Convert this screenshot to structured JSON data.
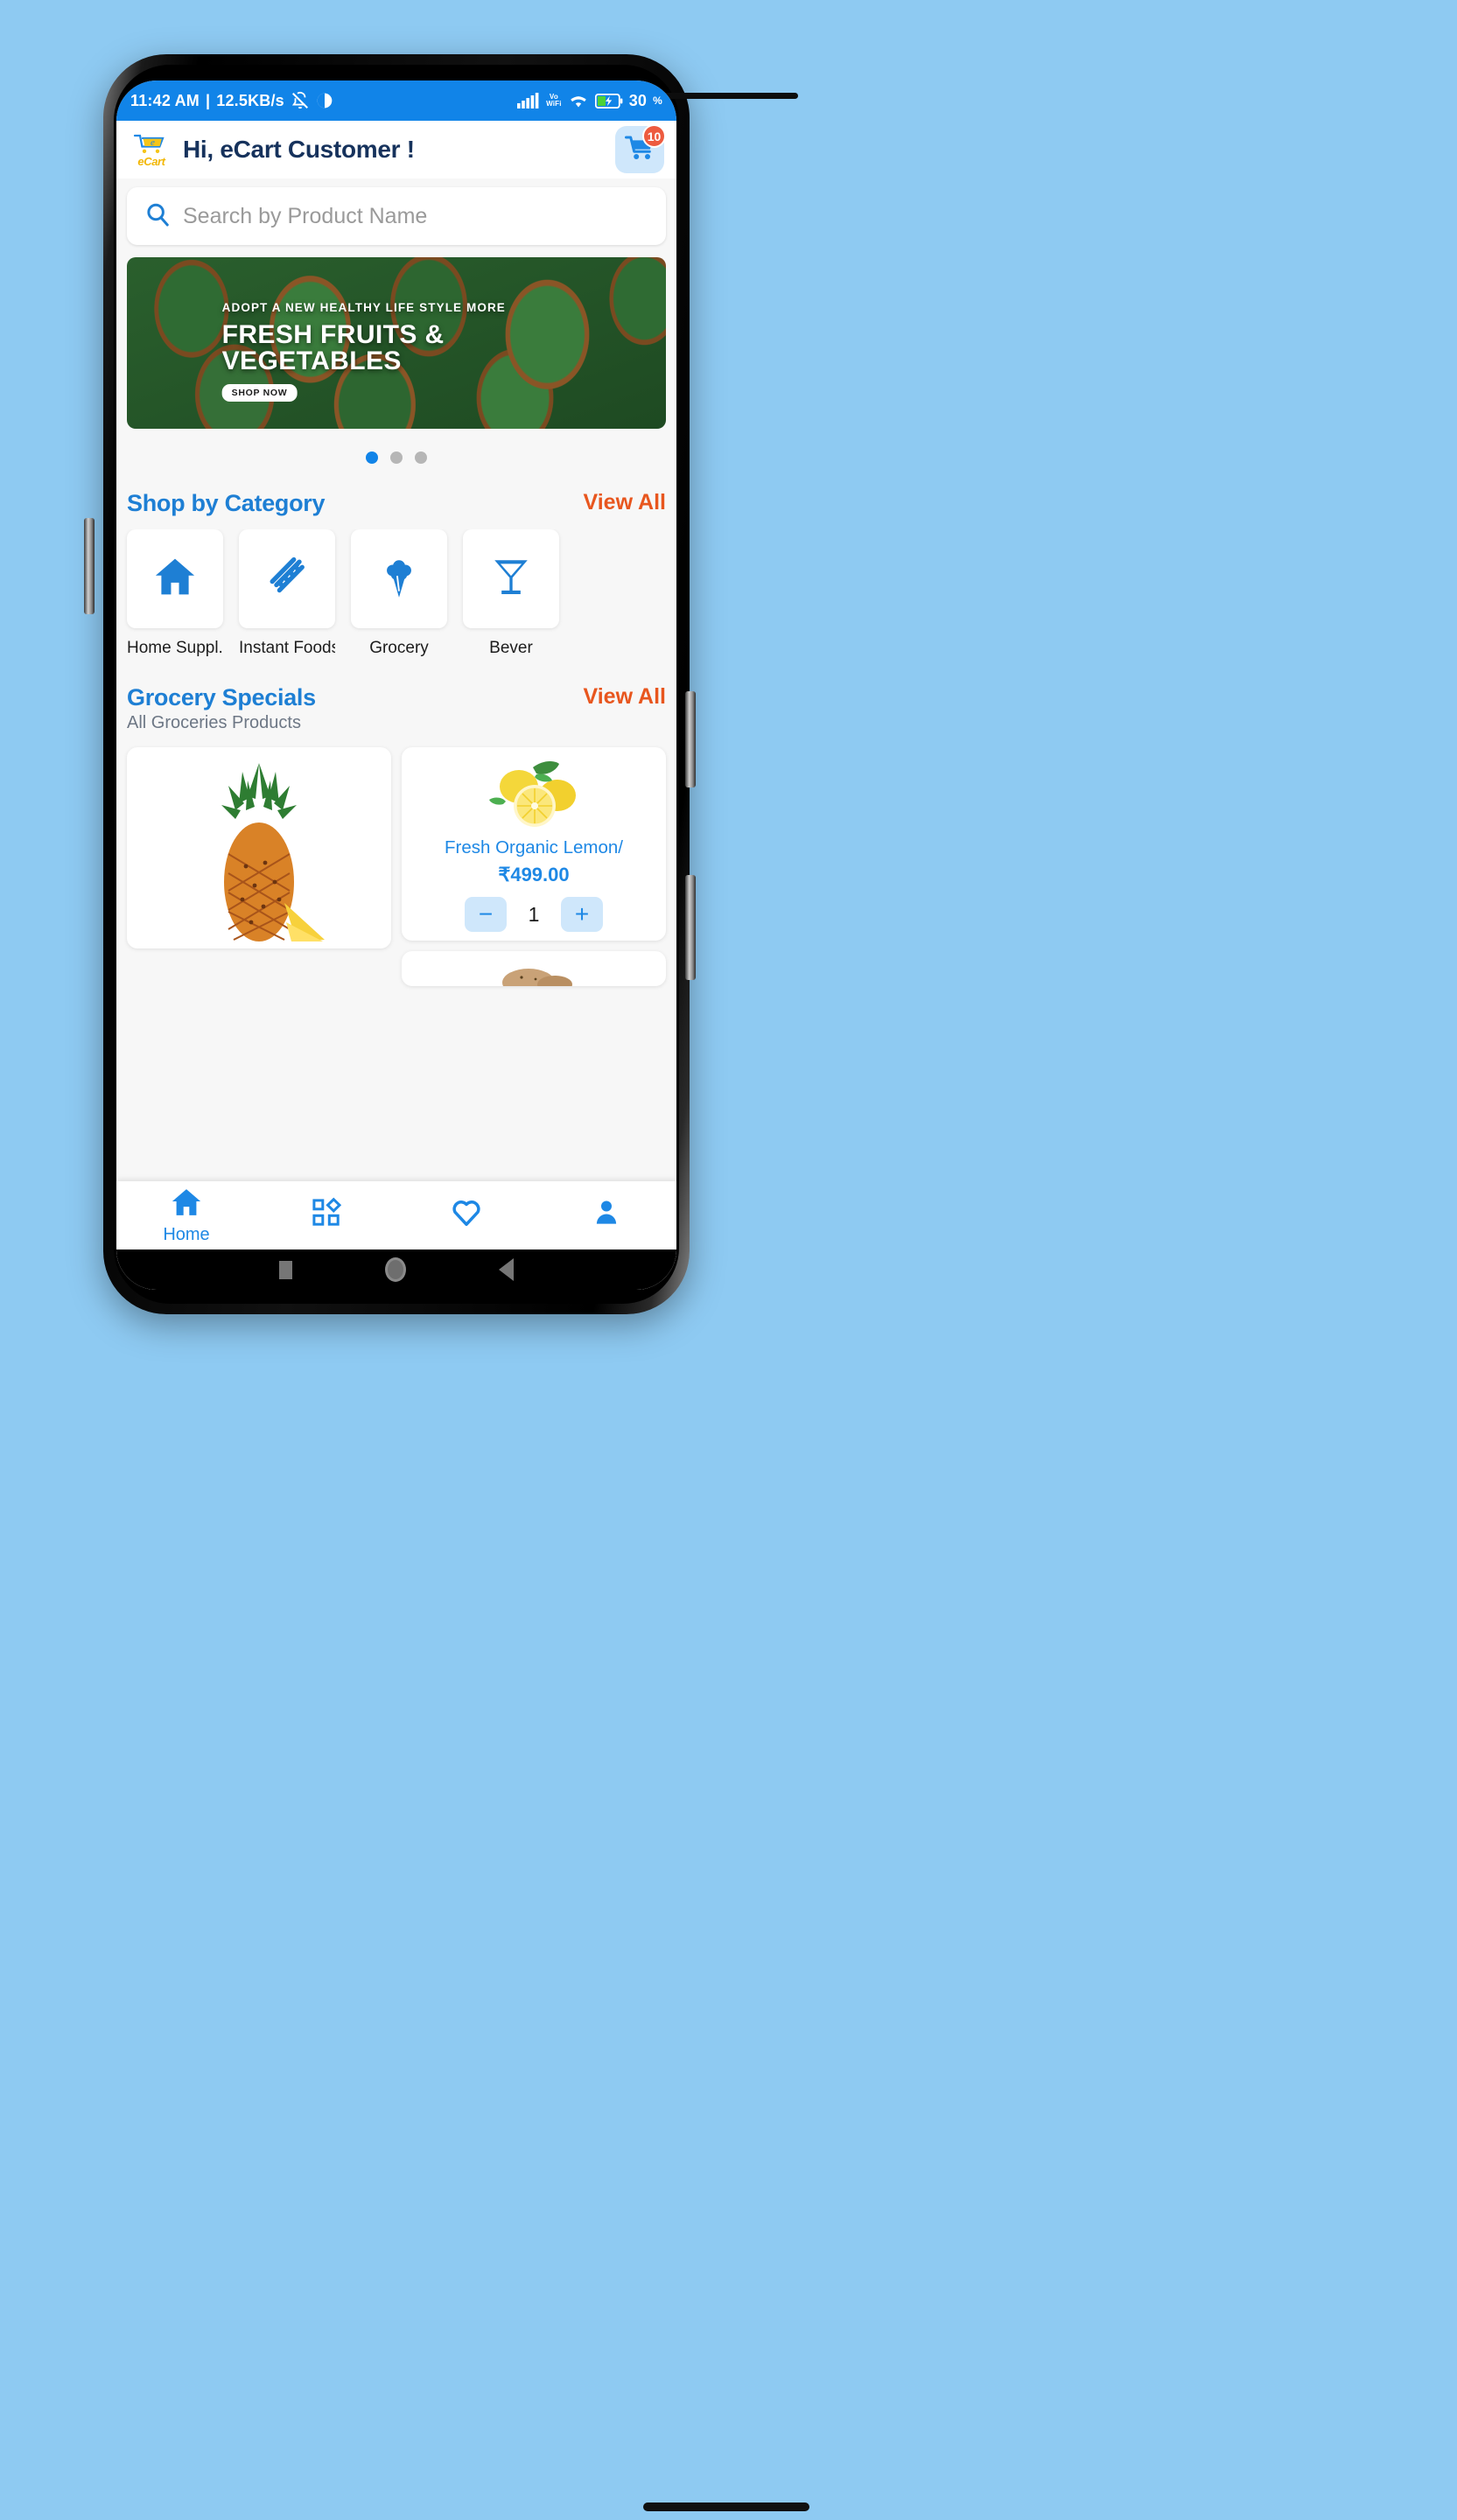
{
  "statusbar": {
    "time": "11:42 AM",
    "separator": "|",
    "network_speed": "12.5KB/s",
    "mute_icon": "bell-muted-icon",
    "dnd_icon": "do-not-disturb-icon",
    "signal_icon": "signal-bars-icon",
    "volte_line1": "Vo",
    "volte_line2": "WiFi",
    "wifi_icon": "wifi-icon",
    "battery_icon": "battery-charging-icon",
    "battery_percent": "30",
    "battery_percent_unit": "%",
    "bg_color": "#1184E8"
  },
  "appbar": {
    "logo_text": "eCart",
    "logo_icon": "shopping-cart-logo-icon",
    "greeting": "Hi, eCart Customer !",
    "cart_icon": "shopping-cart-icon",
    "cart_badge": "10"
  },
  "search": {
    "icon": "search-icon",
    "placeholder": "Search by Product Name",
    "value": ""
  },
  "banner": {
    "kicker": "ADOPT A NEW HEALTHY LIFE STYLE MORE",
    "headline_line1": "FRESH FRUITS &",
    "headline_line2": "VEGETABLES",
    "cta": "SHOP NOW",
    "dots_total": 3,
    "dots_active_index": 0
  },
  "categories_section": {
    "title": "Shop by Category",
    "view_all": "View All",
    "items": [
      {
        "label": "Home Suppl...",
        "icon": "home-icon"
      },
      {
        "label": "Instant Foods",
        "icon": "noodles-icon"
      },
      {
        "label": "Grocery",
        "icon": "broccoli-icon"
      },
      {
        "label": "Bever",
        "icon": "cocktail-glass-icon"
      }
    ]
  },
  "specials_section": {
    "title": "Grocery Specials",
    "subtitle": "All Groceries Products",
    "view_all": "View All",
    "products": [
      {
        "name": "",
        "price": "",
        "image": "pineapple-image",
        "quantity": ""
      },
      {
        "name": "Fresh Organic Lemon/",
        "price": "₹499.00",
        "image": "lemon-image",
        "quantity": "1",
        "decrement_label": "−",
        "increment_label": "+"
      },
      {
        "name": "",
        "price": "",
        "image": "potato-image",
        "quantity": ""
      }
    ]
  },
  "bottomnav": {
    "items": [
      {
        "label": "Home",
        "icon": "home-icon",
        "active": true
      },
      {
        "label": "",
        "icon": "categories-grid-icon",
        "active": false
      },
      {
        "label": "",
        "icon": "heart-icon",
        "active": false
      },
      {
        "label": "",
        "icon": "person-icon",
        "active": false
      }
    ]
  },
  "sysnav": {
    "recents_icon": "square-recents-icon",
    "home_icon": "circle-home-icon",
    "back_icon": "triangle-back-icon"
  },
  "colors": {
    "primary_blue": "#1184E8",
    "accent_orange": "#E8561E",
    "title_blue": "#1E7FD4",
    "badge_red": "#ED5B3F",
    "page_bg": "#8ECAF2",
    "content_bg": "#F7F7F7"
  }
}
